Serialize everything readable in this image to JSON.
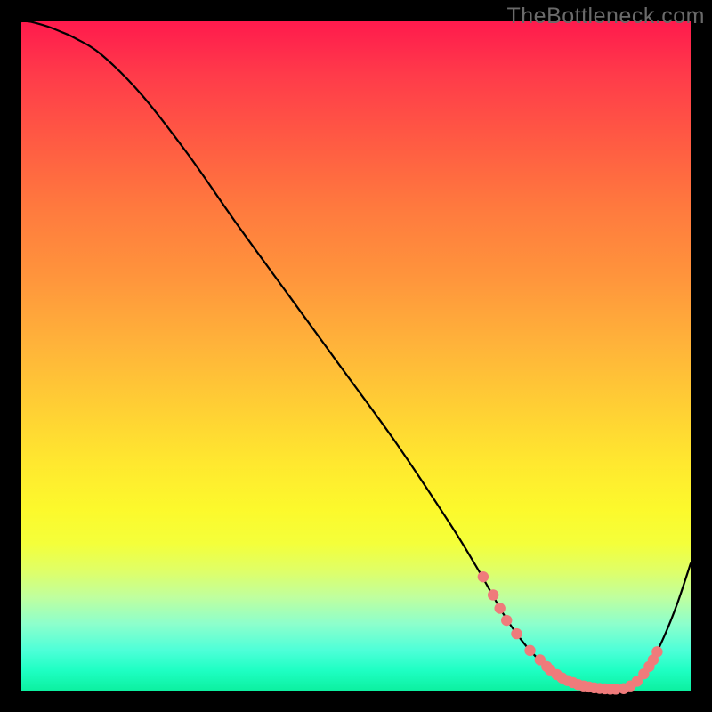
{
  "watermark": "TheBottleneck.com",
  "colors": {
    "background": "#000000",
    "curve": "#000000",
    "dot": "#ef7b7b"
  },
  "chart_data": {
    "type": "line",
    "title": "",
    "xlabel": "",
    "ylabel": "",
    "xlim": [
      0,
      100
    ],
    "ylim": [
      0,
      100
    ],
    "x": [
      0,
      1,
      2,
      4,
      6,
      8,
      12,
      18,
      25,
      32,
      40,
      48,
      56,
      64,
      68,
      70,
      72,
      74,
      76,
      78,
      80,
      82,
      84,
      86,
      88,
      90,
      92,
      94,
      96,
      98,
      100
    ],
    "y": [
      100,
      100,
      99.8,
      99.2,
      98.4,
      97.5,
      95,
      89,
      80,
      70,
      59,
      48,
      37,
      25,
      18.5,
      15,
      11.5,
      8.5,
      6,
      4,
      2.4,
      1.4,
      0.7,
      0.3,
      0.2,
      0.3,
      1.4,
      4,
      8,
      13,
      19
    ],
    "dots_x": [
      69,
      70.5,
      71.5,
      72.5,
      74,
      76,
      77.5,
      78.5,
      79,
      80,
      80.8,
      81.6,
      82.4,
      83.2,
      84,
      84.8,
      85.6,
      86.4,
      87.2,
      88,
      88.8,
      90,
      91,
      92,
      93,
      93.8,
      94.4,
      95
    ],
    "dots_y": [
      17,
      14.3,
      12.3,
      10.5,
      8.5,
      6,
      4.6,
      3.6,
      3.1,
      2.4,
      1.9,
      1.5,
      1.2,
      0.9,
      0.7,
      0.55,
      0.42,
      0.33,
      0.27,
      0.22,
      0.22,
      0.3,
      0.7,
      1.4,
      2.5,
      3.6,
      4.6,
      5.8
    ]
  }
}
